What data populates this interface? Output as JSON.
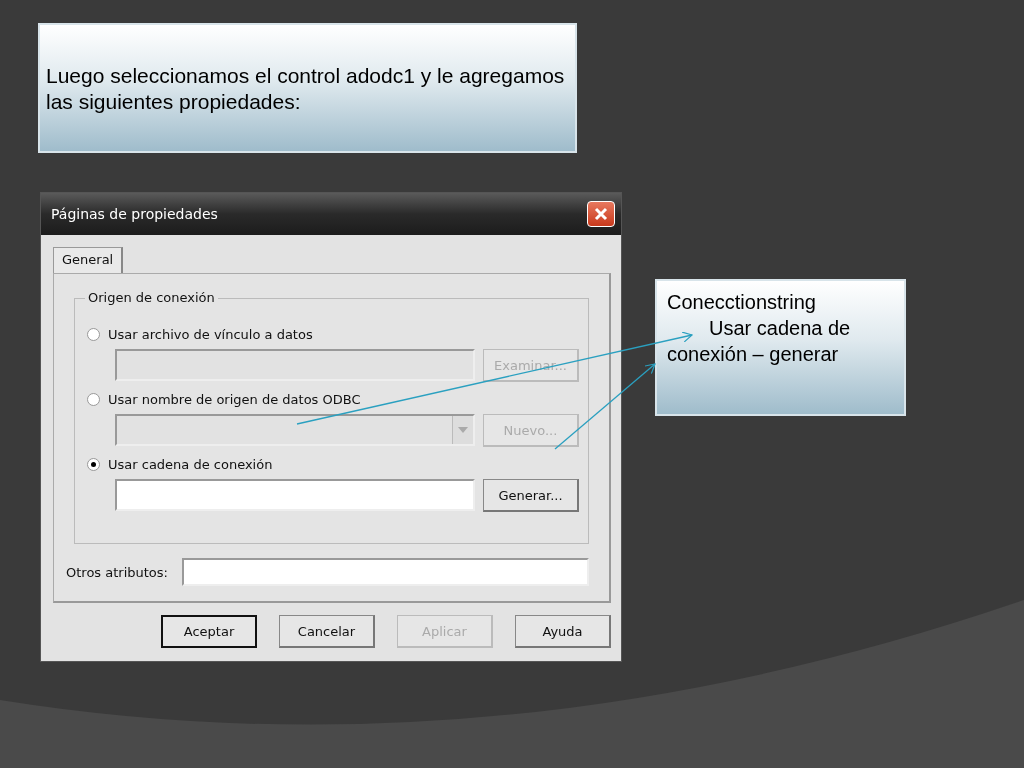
{
  "slide": {
    "title_text": "Luego seleccionamos el control adodc1 y le agregamos las siguientes propiedades:",
    "callout": [
      "Conecctionstring",
      "Usar cadena de conexión – generar"
    ]
  },
  "dialog": {
    "title": "Páginas de propiedades",
    "tabs": [
      {
        "label": "General",
        "selected": true
      }
    ],
    "group": {
      "legend": "Origen de conexión",
      "options": [
        {
          "label": "Usar archivo de vínculo a datos",
          "selected": false,
          "field": {
            "kind": "text",
            "disabled": true
          },
          "button": {
            "label": "Examinar...",
            "disabled": true
          }
        },
        {
          "label": "Usar nombre de origen de datos ODBC",
          "selected": false,
          "field": {
            "kind": "combo",
            "disabled": true
          },
          "button": {
            "label": "Nuevo...",
            "disabled": true
          }
        },
        {
          "label": "Usar cadena de conexión",
          "selected": true,
          "field": {
            "kind": "text",
            "disabled": false
          },
          "button": {
            "label": "Generar...",
            "disabled": false
          }
        }
      ]
    },
    "other_attributes": {
      "label": "Otros atributos:"
    },
    "buttons": [
      {
        "label": "Aceptar",
        "disabled": false,
        "default": true
      },
      {
        "label": "Cancelar",
        "disabled": false,
        "default": false
      },
      {
        "label": "Aplicar",
        "disabled": true,
        "default": false
      },
      {
        "label": "Ayuda",
        "disabled": false,
        "default": false
      }
    ]
  }
}
